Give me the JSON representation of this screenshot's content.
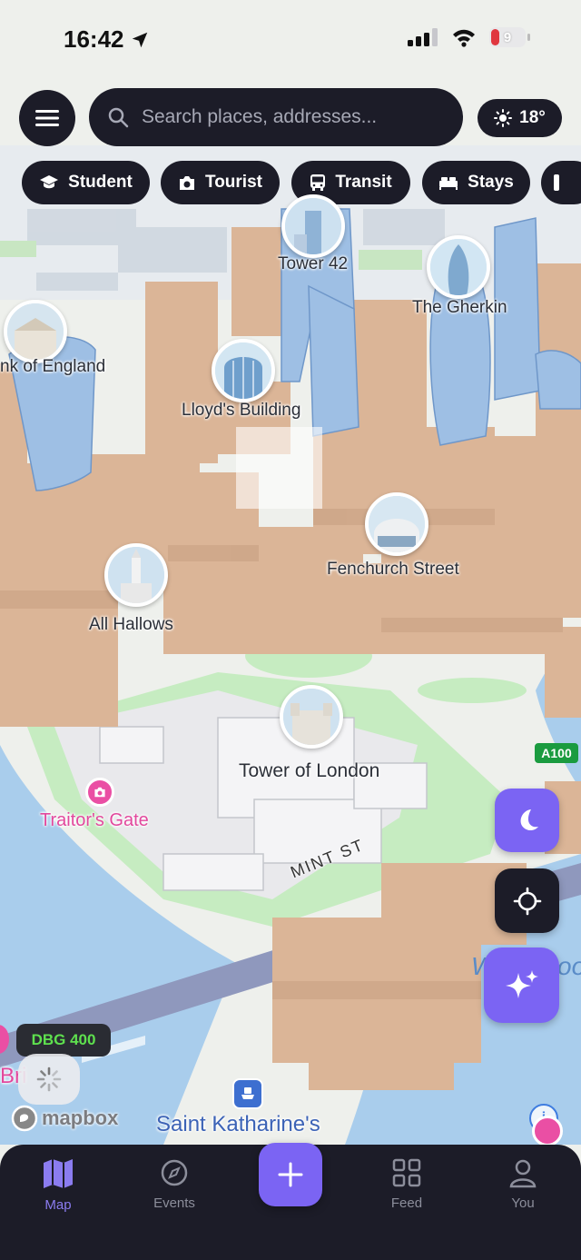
{
  "status_bar": {
    "time": "16:42",
    "battery_level": "9"
  },
  "search": {
    "placeholder": "Search places, addresses..."
  },
  "weather": {
    "temperature": "18°"
  },
  "chips": [
    {
      "label": "Student",
      "icon": "graduation-cap-icon"
    },
    {
      "label": "Tourist",
      "icon": "camera-icon"
    },
    {
      "label": "Transit",
      "icon": "bus-icon"
    },
    {
      "label": "Stays",
      "icon": "bed-icon"
    }
  ],
  "map": {
    "pois": [
      {
        "label": "Tower 42"
      },
      {
        "label": "The Gherkin"
      },
      {
        "label": "nk of England"
      },
      {
        "label": "Lloyd's Building"
      },
      {
        "label": "Fenchurch Street"
      },
      {
        "label": "All Hallows"
      },
      {
        "label": "Tower of London"
      }
    ],
    "traitors_gate": "Traitor's Gate",
    "street": "MINT ST",
    "road_badge": "A100",
    "bus_badge": "DBG 400",
    "area_label": "Saint Katharine's",
    "water_label": "W",
    "water_label_right": "oo",
    "left_partial": "Bri",
    "attribution": "mapbox"
  },
  "controls": {
    "night_mode_icon": "moon-icon",
    "locate_icon": "crosshair-icon",
    "ai_icon": "sparkles-icon"
  },
  "tabs": [
    {
      "label": "Map",
      "icon": "map-icon",
      "active": true
    },
    {
      "label": "Events",
      "icon": "compass-icon",
      "active": false
    },
    {
      "label": "Feed",
      "icon": "grid-icon",
      "active": false
    },
    {
      "label": "You",
      "icon": "person-icon",
      "active": false
    }
  ],
  "colors": {
    "accent": "#7b64f3",
    "dark_ui": "#1c1c28",
    "building": "#dbb597",
    "water": "#a9cdec",
    "park": "#c6ecc1",
    "poi_pink": "#ea4fa4"
  }
}
